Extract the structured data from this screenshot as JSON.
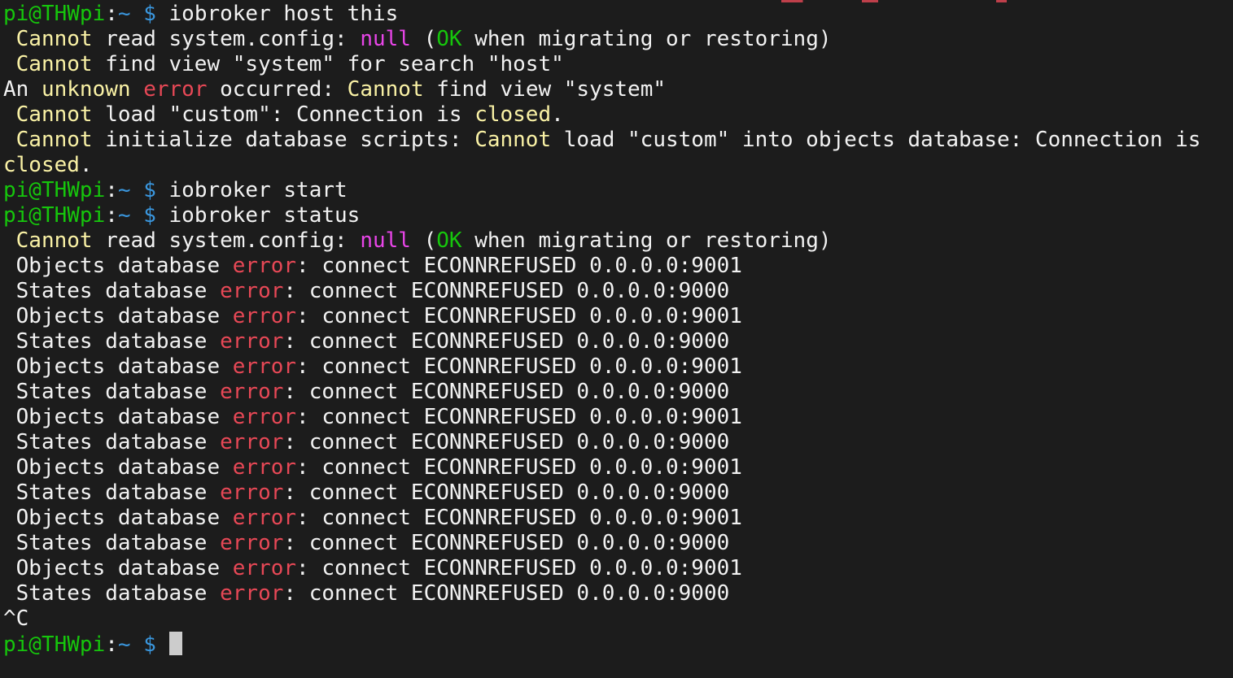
{
  "terminal": {
    "colors": {
      "background": "#1c1c1c",
      "foreground": "#f2f2f2",
      "yellow": "#f9f1a5",
      "red": "#e74856",
      "green": "#16c60c",
      "magenta": "#e845e8",
      "blue": "#3a96dd"
    },
    "lines": [
      [
        {
          "t": "pi@THWpi",
          "c": "green"
        },
        {
          "t": ":",
          "c": "default"
        },
        {
          "t": "~ $",
          "c": "blue"
        },
        {
          "t": " iobroker host this",
          "c": "default"
        }
      ],
      [
        {
          "t": " ",
          "c": "default"
        },
        {
          "t": "Cannot",
          "c": "yellow"
        },
        {
          "t": " read system.config: ",
          "c": "default"
        },
        {
          "t": "null",
          "c": "magenta"
        },
        {
          "t": " (",
          "c": "default"
        },
        {
          "t": "OK",
          "c": "green"
        },
        {
          "t": " when migrating or restoring)",
          "c": "default"
        }
      ],
      [
        {
          "t": " ",
          "c": "default"
        },
        {
          "t": "Cannot",
          "c": "yellow"
        },
        {
          "t": " find view \"system\" for search \"host\"",
          "c": "default"
        }
      ],
      [
        {
          "t": "An ",
          "c": "default"
        },
        {
          "t": "unknown",
          "c": "yellow"
        },
        {
          "t": " ",
          "c": "default"
        },
        {
          "t": "error",
          "c": "red"
        },
        {
          "t": " occurred: ",
          "c": "default"
        },
        {
          "t": "Cannot",
          "c": "yellow"
        },
        {
          "t": " find view \"system\"",
          "c": "default"
        }
      ],
      [
        {
          "t": " ",
          "c": "default"
        },
        {
          "t": "Cannot",
          "c": "yellow"
        },
        {
          "t": " load \"custom\": Connection is ",
          "c": "default"
        },
        {
          "t": "closed",
          "c": "yellow"
        },
        {
          "t": ".",
          "c": "default"
        }
      ],
      [
        {
          "t": " ",
          "c": "default"
        },
        {
          "t": "Cannot",
          "c": "yellow"
        },
        {
          "t": " initialize database scripts: ",
          "c": "default"
        },
        {
          "t": "Cannot",
          "c": "yellow"
        },
        {
          "t": " load \"custom\" into objects database: Connection is",
          "c": "default"
        }
      ],
      [
        {
          "t": "closed",
          "c": "yellow"
        },
        {
          "t": ".",
          "c": "default"
        }
      ],
      [
        {
          "t": "pi@THWpi",
          "c": "green"
        },
        {
          "t": ":",
          "c": "default"
        },
        {
          "t": "~ $",
          "c": "blue"
        },
        {
          "t": " iobroker start",
          "c": "default"
        }
      ],
      [
        {
          "t": "pi@THWpi",
          "c": "green"
        },
        {
          "t": ":",
          "c": "default"
        },
        {
          "t": "~ $",
          "c": "blue"
        },
        {
          "t": " iobroker status",
          "c": "default"
        }
      ],
      [
        {
          "t": " ",
          "c": "default"
        },
        {
          "t": "Cannot",
          "c": "yellow"
        },
        {
          "t": " read system.config: ",
          "c": "default"
        },
        {
          "t": "null",
          "c": "magenta"
        },
        {
          "t": " (",
          "c": "default"
        },
        {
          "t": "OK",
          "c": "green"
        },
        {
          "t": " when migrating or restoring)",
          "c": "default"
        }
      ],
      [
        {
          "t": " Objects database ",
          "c": "default"
        },
        {
          "t": "error",
          "c": "red"
        },
        {
          "t": ": connect ECONNREFUSED 0.0.0.0:9001",
          "c": "default"
        }
      ],
      [
        {
          "t": " States database ",
          "c": "default"
        },
        {
          "t": "error",
          "c": "red"
        },
        {
          "t": ": connect ECONNREFUSED 0.0.0.0:9000",
          "c": "default"
        }
      ],
      [
        {
          "t": " Objects database ",
          "c": "default"
        },
        {
          "t": "error",
          "c": "red"
        },
        {
          "t": ": connect ECONNREFUSED 0.0.0.0:9001",
          "c": "default"
        }
      ],
      [
        {
          "t": " States database ",
          "c": "default"
        },
        {
          "t": "error",
          "c": "red"
        },
        {
          "t": ": connect ECONNREFUSED 0.0.0.0:9000",
          "c": "default"
        }
      ],
      [
        {
          "t": " Objects database ",
          "c": "default"
        },
        {
          "t": "error",
          "c": "red"
        },
        {
          "t": ": connect ECONNREFUSED 0.0.0.0:9001",
          "c": "default"
        }
      ],
      [
        {
          "t": " States database ",
          "c": "default"
        },
        {
          "t": "error",
          "c": "red"
        },
        {
          "t": ": connect ECONNREFUSED 0.0.0.0:9000",
          "c": "default"
        }
      ],
      [
        {
          "t": " Objects database ",
          "c": "default"
        },
        {
          "t": "error",
          "c": "red"
        },
        {
          "t": ": connect ECONNREFUSED 0.0.0.0:9001",
          "c": "default"
        }
      ],
      [
        {
          "t": " States database ",
          "c": "default"
        },
        {
          "t": "error",
          "c": "red"
        },
        {
          "t": ": connect ECONNREFUSED 0.0.0.0:9000",
          "c": "default"
        }
      ],
      [
        {
          "t": " Objects database ",
          "c": "default"
        },
        {
          "t": "error",
          "c": "red"
        },
        {
          "t": ": connect ECONNREFUSED 0.0.0.0:9001",
          "c": "default"
        }
      ],
      [
        {
          "t": " States database ",
          "c": "default"
        },
        {
          "t": "error",
          "c": "red"
        },
        {
          "t": ": connect ECONNREFUSED 0.0.0.0:9000",
          "c": "default"
        }
      ],
      [
        {
          "t": " Objects database ",
          "c": "default"
        },
        {
          "t": "error",
          "c": "red"
        },
        {
          "t": ": connect ECONNREFUSED 0.0.0.0:9001",
          "c": "default"
        }
      ],
      [
        {
          "t": " States database ",
          "c": "default"
        },
        {
          "t": "error",
          "c": "red"
        },
        {
          "t": ": connect ECONNREFUSED 0.0.0.0:9000",
          "c": "default"
        }
      ],
      [
        {
          "t": " Objects database ",
          "c": "default"
        },
        {
          "t": "error",
          "c": "red"
        },
        {
          "t": ": connect ECONNREFUSED 0.0.0.0:9001",
          "c": "default"
        }
      ],
      [
        {
          "t": " States database ",
          "c": "default"
        },
        {
          "t": "error",
          "c": "red"
        },
        {
          "t": ": connect ECONNREFUSED 0.0.0.0:9000",
          "c": "default"
        }
      ],
      [
        {
          "t": "^C",
          "c": "default"
        }
      ],
      [
        {
          "t": "pi@THWpi",
          "c": "green"
        },
        {
          "t": ":",
          "c": "default"
        },
        {
          "t": "~ $",
          "c": "blue"
        },
        {
          "t": " ",
          "c": "default"
        }
      ]
    ],
    "cursor_line": 25
  }
}
